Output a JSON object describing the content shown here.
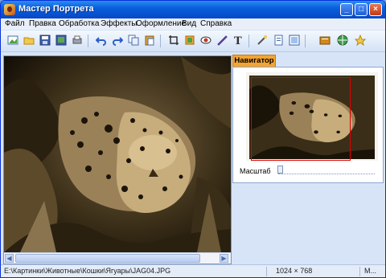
{
  "window": {
    "title": "Мастер Портрета"
  },
  "menu": [
    "Файл",
    "Правка",
    "Обработка",
    "Эффекты",
    "Оформление",
    "Вид",
    "Справка"
  ],
  "toolbar": {
    "icons": [
      "open-image-icon",
      "open-folder-icon",
      "save-icon",
      "save-as-icon",
      "print-icon",
      "undo-icon",
      "redo-icon",
      "copy-icon",
      "paste-icon",
      "crop-icon",
      "rotate-icon",
      "red-eye-icon",
      "brush-icon",
      "text-icon",
      "magic-wand-icon",
      "page-icon",
      "frame-icon",
      "book-icon",
      "web-icon",
      "effects-icon"
    ]
  },
  "navigator": {
    "tab_label": "Навигатор",
    "zoom_label": "Масштаб",
    "zoom_level": 0.0
  },
  "status": {
    "path": "E:\\Картинки\\Животные\\Кошки\\Ягуары\\JAG04.JPG",
    "dimensions": "1024 × 768",
    "mode": "М..."
  },
  "colors": {
    "accent": "#0a5fdc",
    "tab": "#f4a430",
    "sepia_light": "#e8cf9a",
    "sepia_dark": "#1c1408"
  }
}
